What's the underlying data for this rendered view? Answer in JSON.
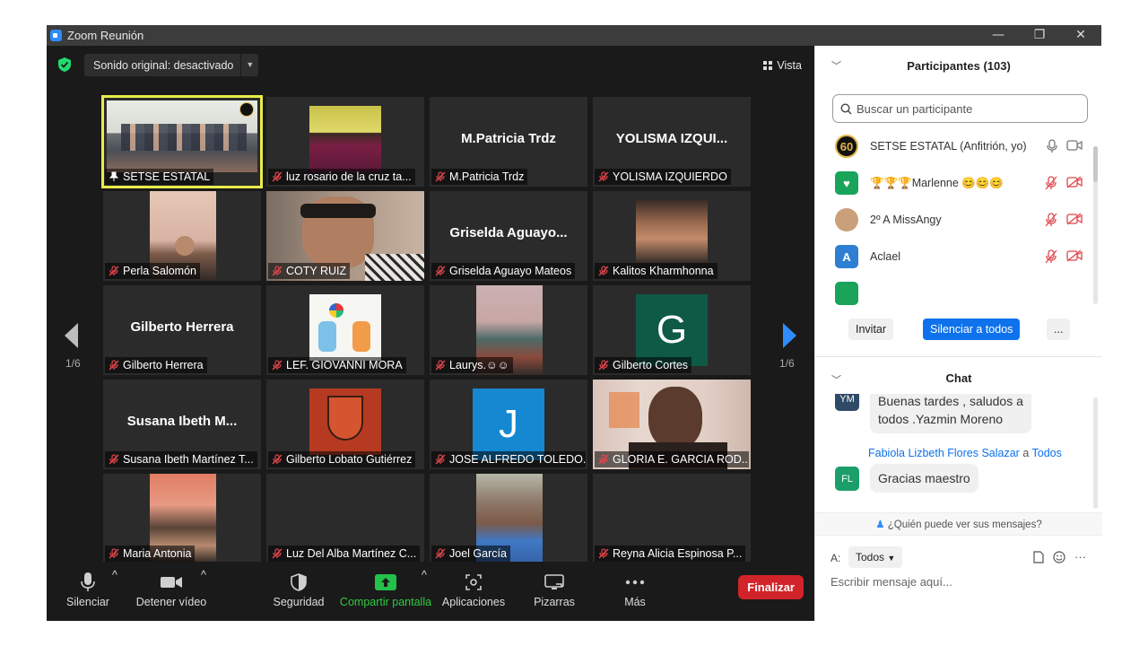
{
  "window": {
    "title": "Zoom Reunión",
    "controls": [
      "—",
      "❐",
      "✕"
    ]
  },
  "topbar": {
    "sound_label": "Sonido original: desactivado",
    "view_label": "Vista"
  },
  "pager": {
    "left": "1/6",
    "right": "1/6"
  },
  "tiles": [
    {
      "label": "SETSE ESTATAL",
      "big": "",
      "kind": "photo-meeting",
      "active": true,
      "muted": false
    },
    {
      "label": "luz rosario de la cruz ta...",
      "big": "",
      "kind": "photo-pink",
      "muted": true
    },
    {
      "label": "M.Patricia Trdz",
      "big": "M.Patricia Trdz",
      "kind": "name",
      "muted": true
    },
    {
      "label": "YOLISMA IZQUIERDO",
      "big": "YOLISMA  IZQUI...",
      "kind": "name",
      "muted": true
    },
    {
      "label": "Perla Salomón",
      "big": "",
      "kind": "photo-face1",
      "muted": true
    },
    {
      "label": "COTY RUIZ",
      "big": "",
      "kind": "photo-coty",
      "muted": true
    },
    {
      "label": "Griselda Aguayo Mateos",
      "big": "Griselda  Aguayo...",
      "kind": "name",
      "muted": true
    },
    {
      "label": "Kalitos Kharmhonna",
      "big": "",
      "kind": "photo-face2",
      "muted": true
    },
    {
      "label": "Gilberto Herrera",
      "big": "Gilberto Herrera",
      "kind": "name",
      "muted": true
    },
    {
      "label": "LEF. GIOVANNI MORA",
      "big": "",
      "kind": "photo-kids",
      "muted": true
    },
    {
      "label": "Laurys.☺☺",
      "big": "",
      "kind": "photo-room",
      "muted": true
    },
    {
      "label": "Gilberto Cortes",
      "big": "",
      "kind": "letter-g",
      "letter": "G",
      "muted": true
    },
    {
      "label": "Susana Ibeth Martínez T...",
      "big": "Susana  Ibeth  M...",
      "kind": "name",
      "muted": true
    },
    {
      "label": "Gilberto Lobato Gutiérrez",
      "big": "",
      "kind": "photo-shield",
      "muted": true
    },
    {
      "label": "JOSE ALFREDO TOLEDO...",
      "big": "",
      "kind": "letter-j",
      "letter": "J",
      "muted": true
    },
    {
      "label": "GLORIA E. GARCIA ROD...",
      "big": "",
      "kind": "photo-gloria",
      "muted": true
    },
    {
      "label": "Maria Antonia",
      "big": "",
      "kind": "photo-face3",
      "muted": true
    },
    {
      "label": "Luz Del Alba Martínez C...",
      "big": "",
      "kind": "blank",
      "muted": true
    },
    {
      "label": "Joel García",
      "big": "",
      "kind": "photo-face4",
      "muted": true
    },
    {
      "label": "Reyna Alicia Espinosa P...",
      "big": "",
      "kind": "blank",
      "muted": true
    }
  ],
  "toolbar": {
    "mute": "Silenciar",
    "video": "Detener vídeo",
    "security": "Seguridad",
    "share": "Compartir pantalla",
    "apps": "Aplicaciones",
    "whiteboards": "Pizarras",
    "more": "Más",
    "end": "Finalizar"
  },
  "participants": {
    "title": "Participantes (103)",
    "search_placeholder": "Buscar un participante",
    "list": [
      {
        "name": "SETSE ESTATAL (Anfitrión, yo)",
        "avatar": "60",
        "avatar_color": "#111111",
        "muted": false
      },
      {
        "name": "🏆🏆🏆Marlenne 😊😊😊",
        "avatar": "♥",
        "avatar_color": "#1aa35a",
        "muted": true
      },
      {
        "name": "2º A  MissAngy",
        "avatar": "",
        "avatar_color": "#c9a07a",
        "muted": true
      },
      {
        "name": "Aclael",
        "avatar": "A",
        "avatar_color": "#2e7fd1",
        "muted": true
      }
    ],
    "invite": "Invitar",
    "mute_all": "Silenciar a todos",
    "more": "..."
  },
  "chat": {
    "title": "Chat",
    "messages": [
      {
        "avatar": "YM",
        "avatar_color": "#2f4a66",
        "text1": "Buenas tardes  , saludos a",
        "text2": "todos  .Yazmin Moreno"
      },
      {
        "avatar": "FL",
        "avatar_color": "#1b9e6a",
        "sender": "Fabiola Lizbeth Flores Salazar",
        "to_word": "a",
        "to": "Todos",
        "text1": "Gracias maestro"
      }
    ],
    "who_can_see": "¿Quién puede ver sus mensajes?",
    "to_label": "A:",
    "to_value": "Todos",
    "input_placeholder": "Escribir mensaje aquí..."
  }
}
